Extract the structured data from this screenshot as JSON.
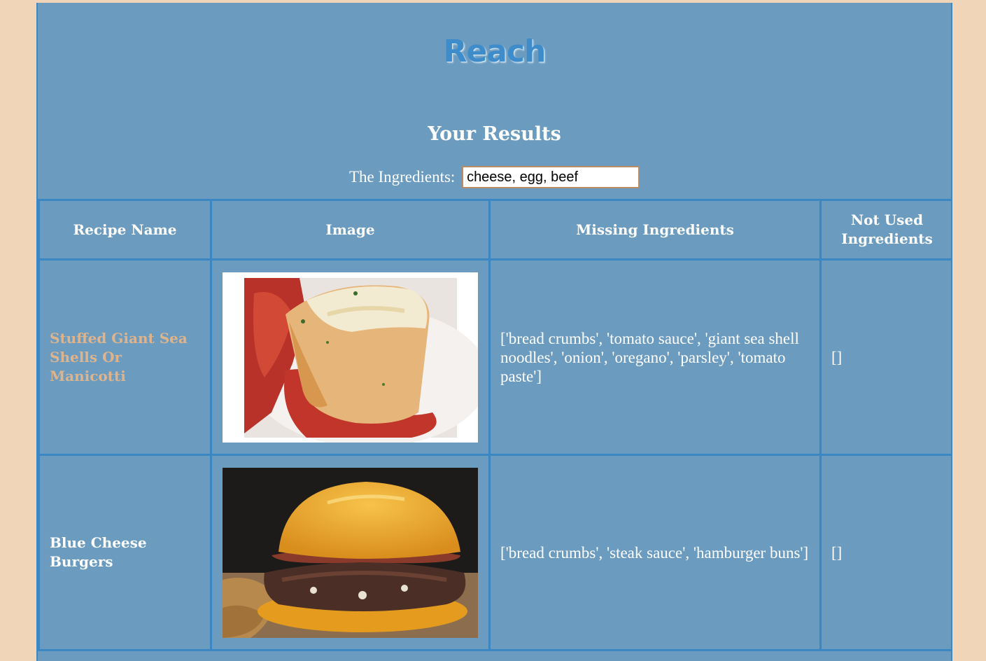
{
  "header": {
    "brand": "Reach",
    "results_title": "Your Results",
    "ingredients_label": "The Ingredients:",
    "ingredients_value": "cheese, egg, beef"
  },
  "table": {
    "columns": [
      "Recipe Name",
      "Image",
      "Missing Ingredients",
      "Not Used Ingredients"
    ],
    "rows": [
      {
        "name": "Stuffed Giant Sea Shells Or Manicotti",
        "image": "stuffed-shells-photo",
        "missing": "['bread crumbs', 'tomato sauce', 'giant sea shell noodles', 'onion', 'oregano', 'parsley', 'tomato paste']",
        "not_used": "[]"
      },
      {
        "name": "Blue Cheese Burgers",
        "image": "burger-photo",
        "missing": "['bread crumbs', 'steak sauce', 'hamburger buns']",
        "not_used": "[]"
      }
    ]
  },
  "colors": {
    "page_bg": "#f0d5b8",
    "panel_bg": "#6b9bbf",
    "border": "#3b87c3",
    "brand": "#3f8ccb",
    "link": "#deb48c"
  }
}
